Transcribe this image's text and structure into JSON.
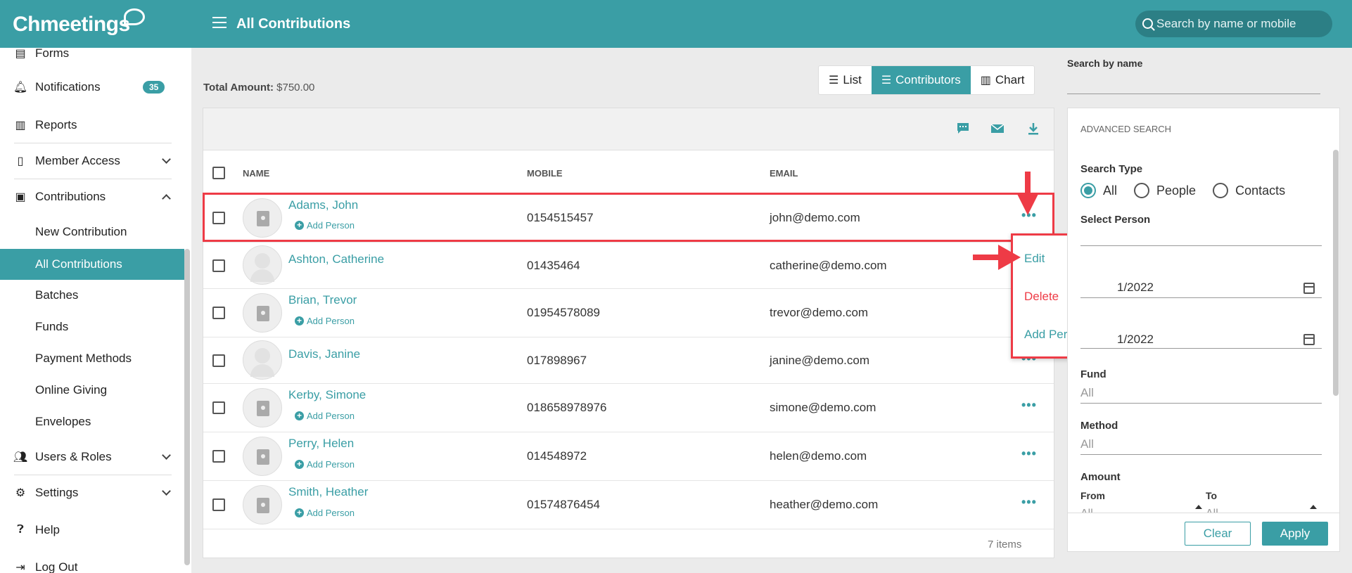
{
  "header": {
    "logo": "Chmeetings",
    "title": "All Contributions",
    "search_placeholder": "Search by name or mobile",
    "color": "#3a9ea5"
  },
  "sidebar": {
    "items": [
      {
        "label": "Forms",
        "icon": "form-icon"
      },
      {
        "label": "Notifications",
        "icon": "bell-icon",
        "badge": "35"
      },
      {
        "label": "Reports",
        "icon": "chart-icon"
      },
      {
        "label": "Member Access",
        "icon": "phone-icon"
      },
      {
        "label": "Contributions",
        "icon": "money-icon"
      },
      {
        "label": "Users & Roles",
        "icon": "users-icon"
      },
      {
        "label": "Settings",
        "icon": "gear-icon"
      },
      {
        "label": "Help",
        "icon": "help-icon"
      },
      {
        "label": "Log Out",
        "icon": "logout-icon"
      }
    ],
    "sub_items": [
      {
        "label": "New Contribution"
      },
      {
        "label": "All Contributions",
        "active": true
      },
      {
        "label": "Batches"
      },
      {
        "label": "Funds"
      },
      {
        "label": "Payment Methods"
      },
      {
        "label": "Online Giving"
      },
      {
        "label": "Envelopes"
      }
    ]
  },
  "main": {
    "total_label": "Total Amount:",
    "total_value": "$750.00",
    "view_tabs": [
      {
        "label": "List",
        "icon": "list-icon"
      },
      {
        "label": "Contributors",
        "icon": "list-detail-icon",
        "active": true
      },
      {
        "label": "Chart",
        "icon": "bar-chart-icon"
      }
    ],
    "toolbar_icons": [
      "message-icon",
      "mail-icon",
      "download-icon"
    ],
    "columns": [
      "NAME",
      "MOBILE",
      "EMAIL"
    ],
    "add_person_label": "Add Person",
    "rows": [
      {
        "name": "Adams, John",
        "mobile": "0154515457",
        "email": "john@demo.com",
        "has_add": true
      },
      {
        "name": "Ashton, Catherine",
        "mobile": "01435464",
        "email": "catherine@demo.com",
        "has_add": false
      },
      {
        "name": "Brian, Trevor",
        "mobile": "01954578089",
        "email": "trevor@demo.com",
        "has_add": true
      },
      {
        "name": "Davis, Janine",
        "mobile": "017898967",
        "email": "janine@demo.com",
        "has_add": false
      },
      {
        "name": "Kerby, Simone",
        "mobile": "018658978976",
        "email": "simone@demo.com",
        "has_add": true
      },
      {
        "name": "Perry, Helen",
        "mobile": "014548972",
        "email": "helen@demo.com",
        "has_add": true
      },
      {
        "name": "Smith, Heather",
        "mobile": "01574876454",
        "email": "heather@demo.com",
        "has_add": true
      }
    ],
    "items_count": "7 items",
    "menu": {
      "edit": "Edit",
      "delete": "Delete",
      "add_person": "Add Person",
      "delete_color": "#ee3b46"
    }
  },
  "right_panel": {
    "search_by_name_label": "Search by name",
    "advanced_title": "ADVANCED SEARCH",
    "search_type_label": "Search Type",
    "search_types": [
      "All",
      "People",
      "Contacts"
    ],
    "select_person_label": "Select Person",
    "date_from_value": "1/2022",
    "date_to_value": "1/2022",
    "fund_label": "Fund",
    "fund_value": "All",
    "method_label": "Method",
    "method_value": "All",
    "amount_label": "Amount",
    "amount_from_label": "From",
    "amount_to_label": "To",
    "amount_from_value": "All",
    "amount_to_value": "All",
    "clear_label": "Clear",
    "apply_label": "Apply"
  }
}
